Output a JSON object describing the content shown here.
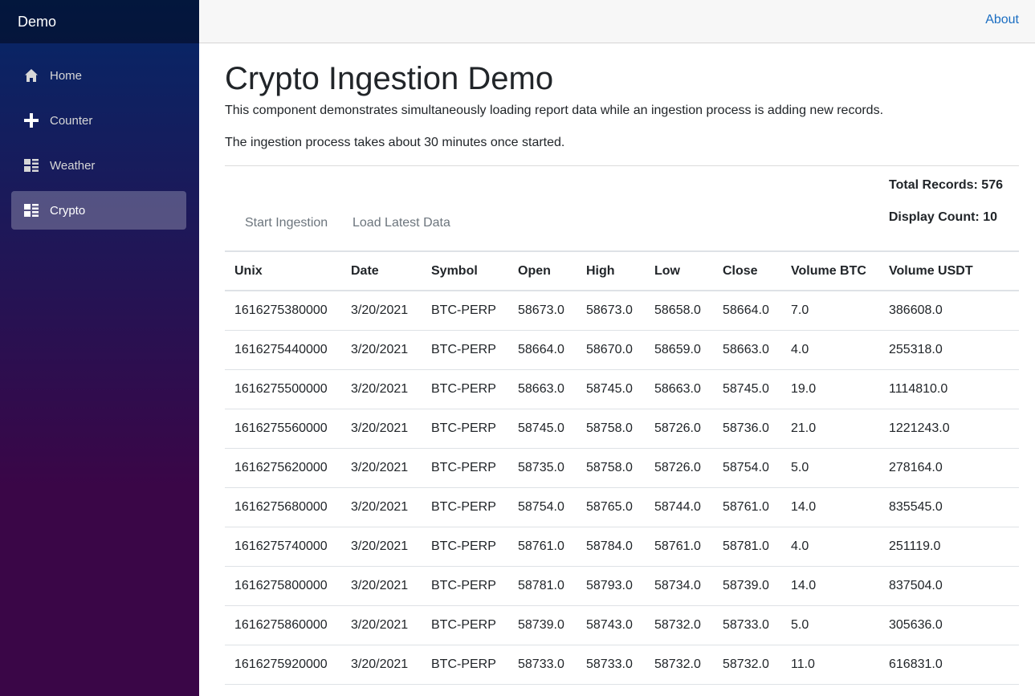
{
  "app": {
    "brand": "Demo"
  },
  "nav": [
    {
      "label": "Home",
      "icon": "home-icon",
      "active": false
    },
    {
      "label": "Counter",
      "icon": "plus-icon",
      "active": false
    },
    {
      "label": "Weather",
      "icon": "list-rich-icon",
      "active": false
    },
    {
      "label": "Crypto",
      "icon": "list-rich-icon",
      "active": true
    }
  ],
  "topbar": {
    "about": "About"
  },
  "page": {
    "title": "Crypto Ingestion Demo",
    "description": "This component demonstrates simultaneously loading report data while an ingestion process is adding new records.",
    "note": "The ingestion process takes about 30 minutes once started."
  },
  "controls": {
    "start_label": "Start Ingestion",
    "load_label": "Load Latest Data",
    "total_records": "Total Records: 576",
    "display_count": "Display Count: 10"
  },
  "table": {
    "headers": [
      "Unix",
      "Date",
      "Symbol",
      "Open",
      "High",
      "Low",
      "Close",
      "Volume BTC",
      "Volume USDT"
    ],
    "rows": [
      [
        "1616275380000",
        "3/20/2021",
        "BTC-PERP",
        "58673.0",
        "58673.0",
        "58658.0",
        "58664.0",
        "7.0",
        "386608.0"
      ],
      [
        "1616275440000",
        "3/20/2021",
        "BTC-PERP",
        "58664.0",
        "58670.0",
        "58659.0",
        "58663.0",
        "4.0",
        "255318.0"
      ],
      [
        "1616275500000",
        "3/20/2021",
        "BTC-PERP",
        "58663.0",
        "58745.0",
        "58663.0",
        "58745.0",
        "19.0",
        "1114810.0"
      ],
      [
        "1616275560000",
        "3/20/2021",
        "BTC-PERP",
        "58745.0",
        "58758.0",
        "58726.0",
        "58736.0",
        "21.0",
        "1221243.0"
      ],
      [
        "1616275620000",
        "3/20/2021",
        "BTC-PERP",
        "58735.0",
        "58758.0",
        "58726.0",
        "58754.0",
        "5.0",
        "278164.0"
      ],
      [
        "1616275680000",
        "3/20/2021",
        "BTC-PERP",
        "58754.0",
        "58765.0",
        "58744.0",
        "58761.0",
        "14.0",
        "835545.0"
      ],
      [
        "1616275740000",
        "3/20/2021",
        "BTC-PERP",
        "58761.0",
        "58784.0",
        "58761.0",
        "58781.0",
        "4.0",
        "251119.0"
      ],
      [
        "1616275800000",
        "3/20/2021",
        "BTC-PERP",
        "58781.0",
        "58793.0",
        "58734.0",
        "58739.0",
        "14.0",
        "837504.0"
      ],
      [
        "1616275860000",
        "3/20/2021",
        "BTC-PERP",
        "58739.0",
        "58743.0",
        "58732.0",
        "58733.0",
        "5.0",
        "305636.0"
      ],
      [
        "1616275920000",
        "3/20/2021",
        "BTC-PERP",
        "58733.0",
        "58733.0",
        "58732.0",
        "58732.0",
        "11.0",
        "616831.0"
      ]
    ]
  }
}
